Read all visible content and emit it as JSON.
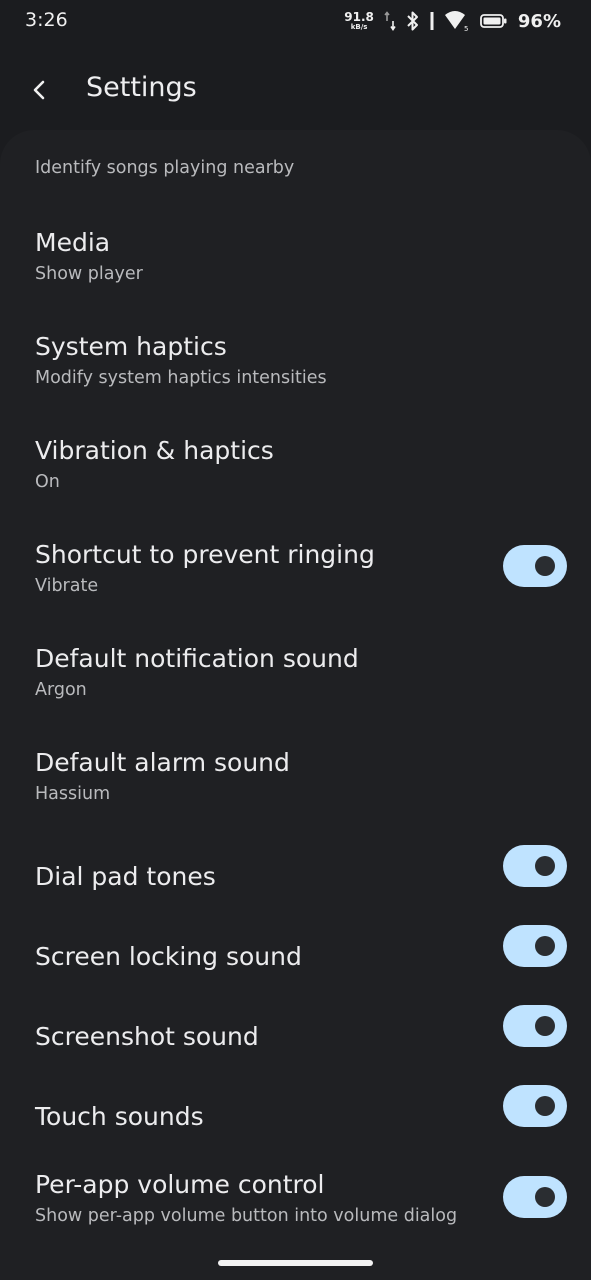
{
  "status_bar": {
    "time": "3:26",
    "net_speed_value": "91.8",
    "net_speed_unit": "kB/s",
    "battery_percent": "96%",
    "icons": [
      "data-arrows-icon",
      "bluetooth-icon",
      "wifi-icon",
      "battery-icon"
    ]
  },
  "appbar": {
    "title": "Settings",
    "back_icon": "chevron-left-icon"
  },
  "list": {
    "partial_subtitle": "Identify songs playing nearby",
    "items": [
      {
        "title": "Media",
        "subtitle": "Show player"
      },
      {
        "title": "System haptics",
        "subtitle": "Modify system haptics intensities"
      },
      {
        "title": "Vibration & haptics",
        "subtitle": "On"
      },
      {
        "title": "Shortcut to prevent ringing",
        "subtitle": "Vibrate",
        "toggle": true
      },
      {
        "title": "Default notification sound",
        "subtitle": "Argon"
      },
      {
        "title": "Default alarm sound",
        "subtitle": "Hassium"
      },
      {
        "title": "Dial pad tones",
        "subtitle": "",
        "toggle": true
      },
      {
        "title": "Screen locking sound",
        "subtitle": "",
        "toggle": true
      },
      {
        "title": "Screenshot sound",
        "subtitle": "",
        "toggle": true
      },
      {
        "title": "Touch sounds",
        "subtitle": "",
        "toggle": true
      },
      {
        "title": "Per-app volume control",
        "subtitle": "Show per-app volume button into volume dialog",
        "toggle": true
      }
    ]
  },
  "colors": {
    "background": "#1b1c1f",
    "card": "#1f2023",
    "toggle_track_on": "#bfe3ff",
    "toggle_knob": "#2a2d31"
  }
}
